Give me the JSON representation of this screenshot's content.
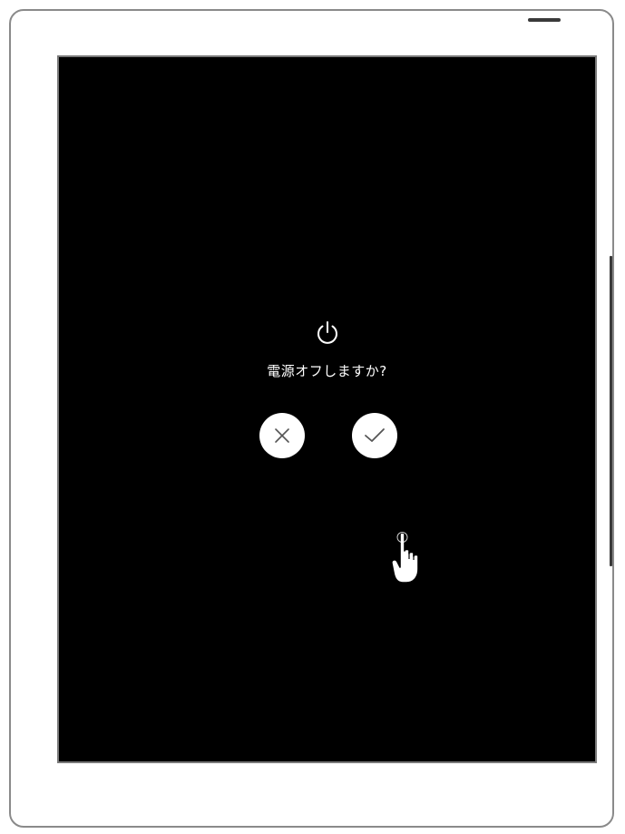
{
  "dialog": {
    "message": "電源オフしますか?"
  },
  "buttons": {
    "cancel_icon": "close-icon",
    "confirm_icon": "checkmark-icon"
  },
  "icons": {
    "header": "power-icon",
    "pointer": "tapping-hand-icon"
  },
  "colors": {
    "screen_bg": "#000000",
    "button_bg": "#ffffff",
    "device_frame": "#8a8a8a"
  }
}
